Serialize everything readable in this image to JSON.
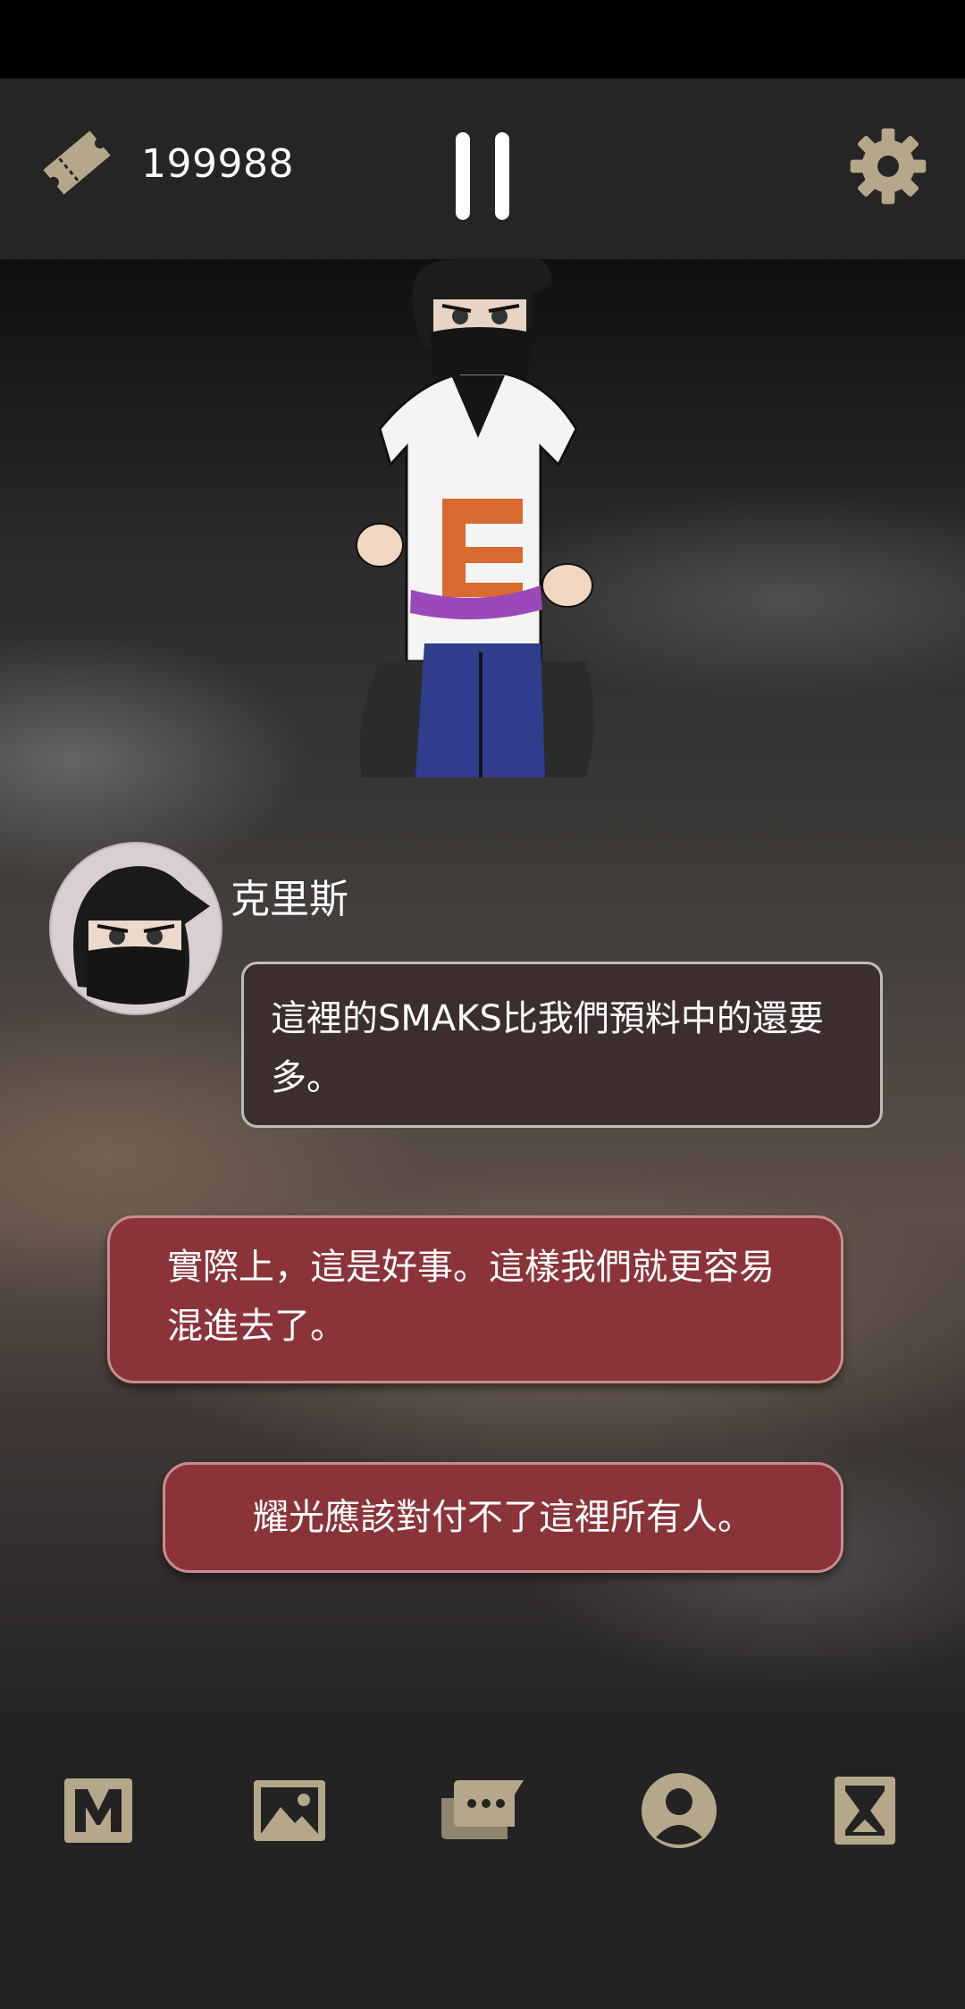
{
  "header": {
    "ticket_count": "199988"
  },
  "dialogue": {
    "speaker": "克里斯",
    "line": "這裡的SMAKS比我們預料中的還要多。"
  },
  "choices": [
    {
      "text": "實際上，這是好事。這樣我們就更容易混進去了。"
    },
    {
      "text": "耀光應該對付不了這裡所有人。"
    }
  ],
  "nav": {
    "icons": [
      "menu-m-icon",
      "gallery-icon",
      "chat-log-icon",
      "profile-icon",
      "hourglass-icon"
    ]
  },
  "colors": {
    "accent_gold": "#b5a88a",
    "choice_red": "#8a343a",
    "dialogue_bg": "#3b2e2c"
  }
}
